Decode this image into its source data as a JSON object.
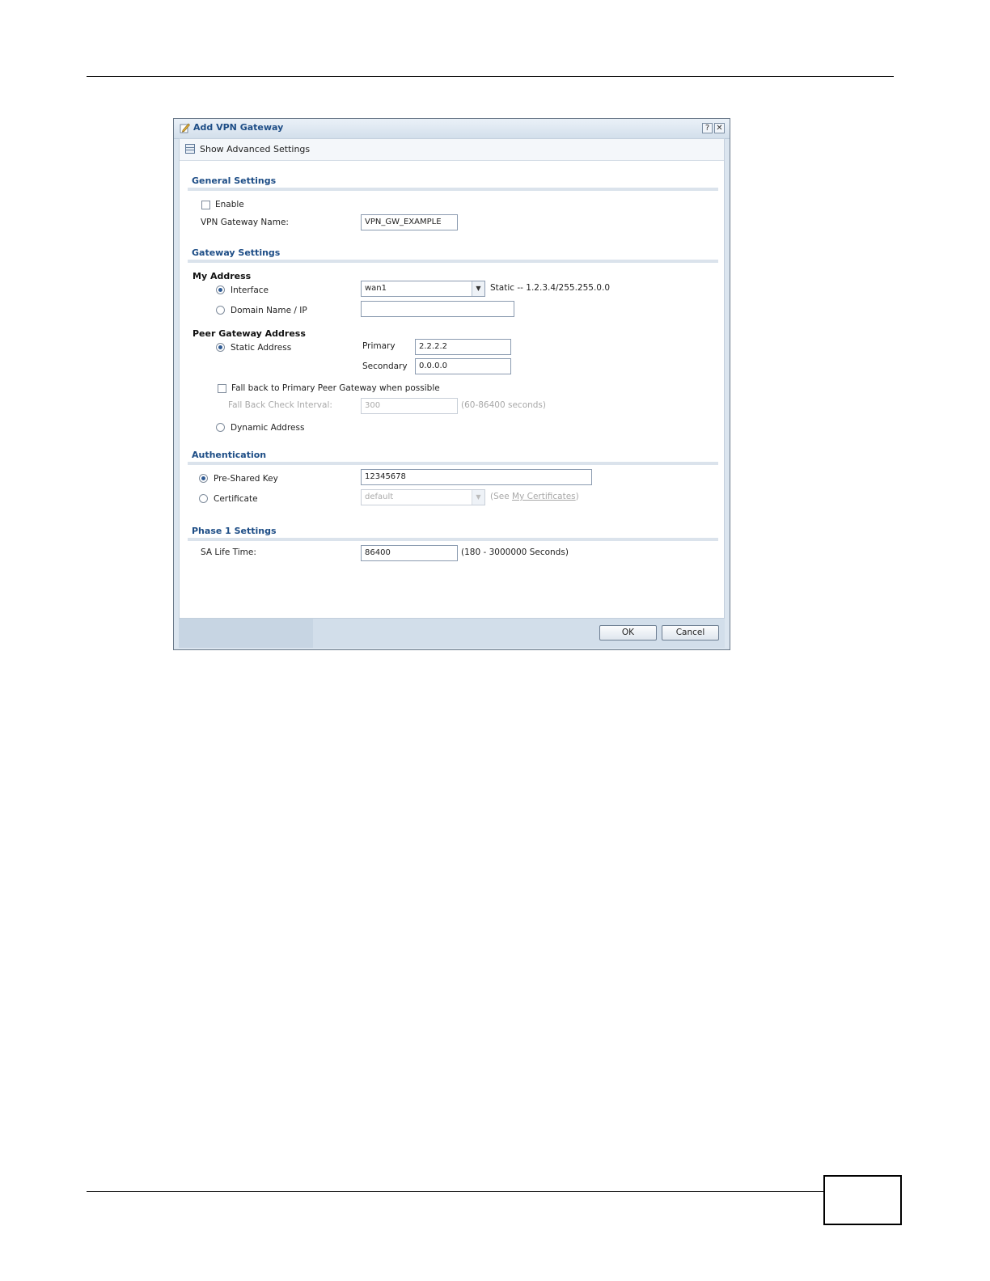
{
  "dialog": {
    "title": "Add VPN Gateway",
    "help_glyph": "?",
    "close_glyph": "✕",
    "show_advanced": "Show Advanced Settings"
  },
  "general": {
    "title": "General Settings",
    "enable_label": "Enable",
    "enable_checked": false,
    "name_label": "VPN Gateway Name:",
    "name_value": "VPN_GW_EXAMPLE"
  },
  "gateway": {
    "title": "Gateway Settings",
    "my_address_title": "My Address",
    "interface_label": "Interface",
    "interface_value": "wan1",
    "interface_info": "Static -- 1.2.3.4/255.255.0.0",
    "domain_label": "Domain Name / IP",
    "domain_value": "",
    "peer_title": "Peer Gateway Address",
    "static_label": "Static Address",
    "primary_label": "Primary",
    "primary_value": "2.2.2.2",
    "secondary_label": "Secondary",
    "secondary_value": "0.0.0.0",
    "fallback_label": "Fall back to Primary Peer Gateway when possible",
    "fallback_checked": false,
    "fallback_interval_label": "Fall Back Check Interval:",
    "fallback_interval_value": "300",
    "fallback_interval_hint": "(60-86400 seconds)",
    "dynamic_label": "Dynamic Address"
  },
  "auth": {
    "title": "Authentication",
    "psk_label": "Pre-Shared Key",
    "psk_value": "12345678",
    "cert_label": "Certificate",
    "cert_value": "default",
    "cert_hint_prefix": "(See ",
    "cert_hint_link": "My Certificates",
    "cert_hint_suffix": ")"
  },
  "phase1": {
    "title": "Phase 1 Settings",
    "sa_label": "SA Life Time:",
    "sa_value": "86400",
    "sa_hint": "(180 - 3000000 Seconds)"
  },
  "footer": {
    "ok_label": "OK",
    "cancel_label": "Cancel"
  },
  "icons": [
    "pencil-icon",
    "help-icon",
    "close-icon",
    "table-icon",
    "chevron-down-icon"
  ]
}
